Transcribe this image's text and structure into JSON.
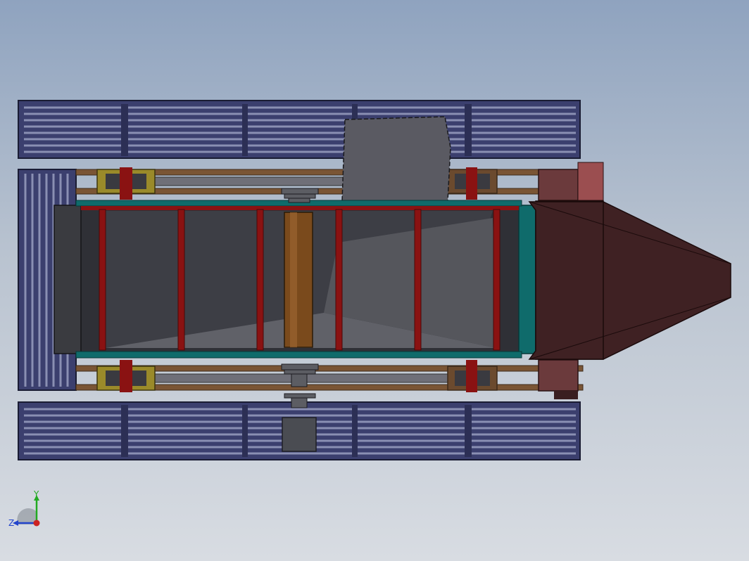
{
  "scene": {
    "view": "top",
    "colors": {
      "background_top": "#8fa3bf",
      "background_bottom": "#d8dce2",
      "track_panel": "#3b3f6e",
      "track_slat": "#8a8fb3",
      "frame_rail": "#7a5535",
      "bearing_housing": "#9a8a2a",
      "red_member": "#8a1212",
      "teal_rail": "#0f6b6b",
      "chute_interior": "#4a4a50",
      "roller": "#7a4a1c",
      "hopper": "#3f2123",
      "hopper_bracket": "#9b4e50"
    }
  },
  "triad": {
    "y_label": "Y",
    "z_label": "Z",
    "y_color": "#22aa22",
    "z_color": "#2244cc",
    "x_color": "#cc2222"
  }
}
